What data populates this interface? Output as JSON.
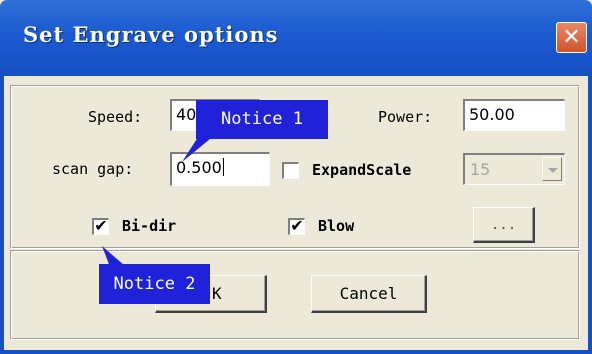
{
  "window": {
    "title": "Set Engrave options",
    "close_glyph": "✕"
  },
  "fields": {
    "speed_label": "Speed:",
    "speed_value": "40",
    "power_label": "Power:",
    "power_value": "50.00",
    "scan_gap_label": "scan gap:",
    "scan_gap_value": "0.500",
    "expand_scale_label": "ExpandScale",
    "expand_scale_checked": false,
    "expand_scale_value": "15"
  },
  "options": {
    "bidir_label": "Bi-dir",
    "bidir_checked": true,
    "blow_label": "Blow",
    "blow_checked": true,
    "more_label": "..."
  },
  "buttons": {
    "ok_label": "OK",
    "ok_visible_fragment": "K",
    "cancel_label": "Cancel"
  },
  "callouts": {
    "notice1": "Notice 1",
    "notice2": "Notice 2"
  },
  "icons": {
    "close": "close-icon",
    "check": "checkmark-icon",
    "dropdown": "chevron-down-icon"
  },
  "colors": {
    "titlebar": "#1650c4",
    "close_button": "#d2542c",
    "dialog_bg": "#ece9d8",
    "callout": "#1f22d8"
  }
}
